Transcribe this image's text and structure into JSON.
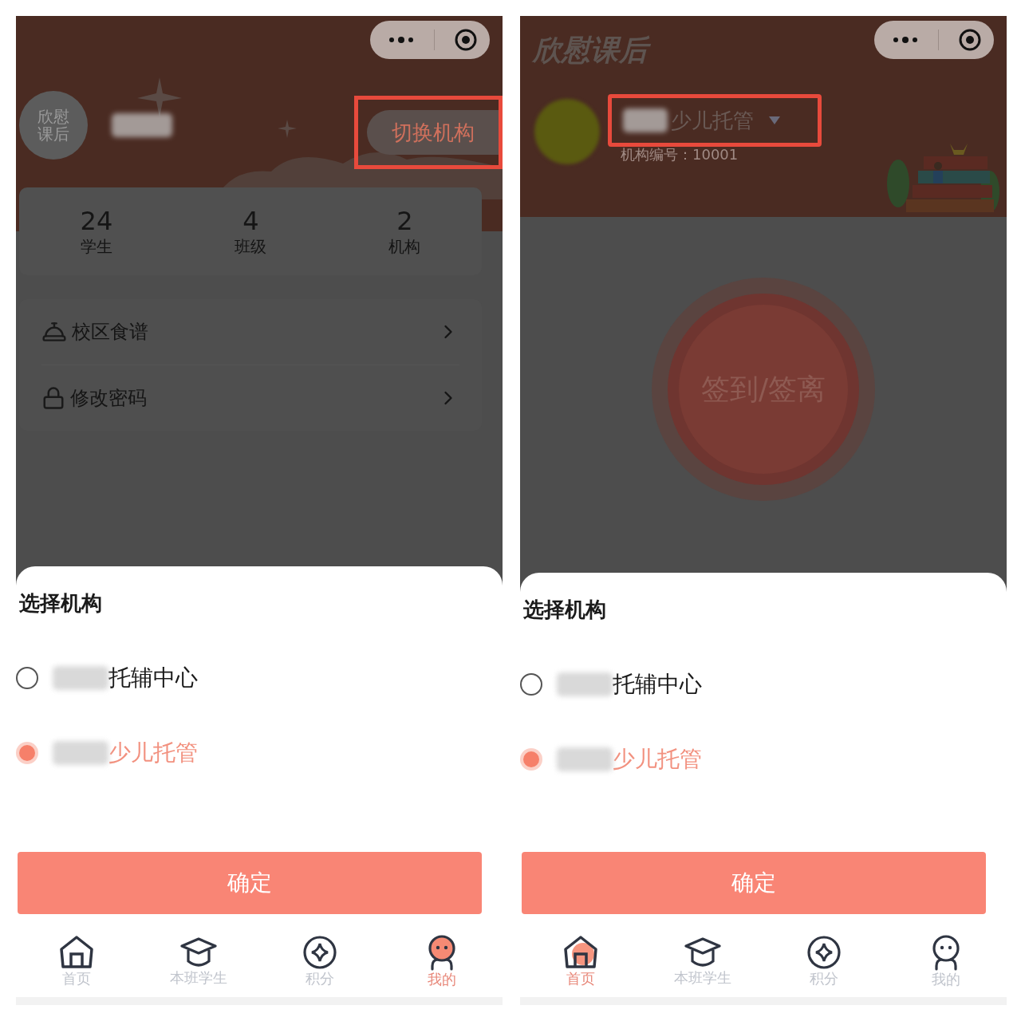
{
  "panels": [
    {
      "kind": "profile",
      "header": {
        "avatar_text": "欣慰课后",
        "switch_button": {
          "label": "切换机构",
          "highlighted": true
        }
      },
      "stats": [
        {
          "value": "24",
          "label": "学生"
        },
        {
          "value": "4",
          "label": "班级"
        },
        {
          "value": "2",
          "label": "机构"
        }
      ],
      "menu": [
        {
          "kind": "recipe",
          "label": "校区食谱"
        },
        {
          "kind": "password",
          "label": "修改密码"
        }
      ],
      "sheet": {
        "title": "选择机构",
        "options": [
          {
            "label": "托辅中心",
            "selected": false
          },
          {
            "label": "少儿托管",
            "selected": true
          }
        ],
        "confirm": "确定"
      },
      "tabbar": [
        {
          "kind": "home",
          "label": "首页",
          "selected": false
        },
        {
          "kind": "class",
          "label": "本班学生",
          "selected": false
        },
        {
          "kind": "points",
          "label": "积分",
          "selected": false
        },
        {
          "kind": "me",
          "label": "我的",
          "selected": true
        }
      ]
    },
    {
      "kind": "home",
      "header": {
        "logo": "欣慰课后",
        "org_name": {
          "label": "少儿托管",
          "highlighted": true
        },
        "org_code": "机构编号：10001"
      },
      "checkin_button": "签到/签离",
      "sheet": {
        "title": "选择机构",
        "options": [
          {
            "label": "托辅中心",
            "selected": false
          },
          {
            "label": "少儿托管",
            "selected": true
          }
        ],
        "confirm": "确定"
      },
      "tabbar": [
        {
          "kind": "home",
          "label": "首页",
          "selected": true
        },
        {
          "kind": "class",
          "label": "本班学生",
          "selected": false
        },
        {
          "kind": "points",
          "label": "积分",
          "selected": false
        },
        {
          "kind": "me",
          "label": "我的",
          "selected": false
        }
      ]
    }
  ]
}
